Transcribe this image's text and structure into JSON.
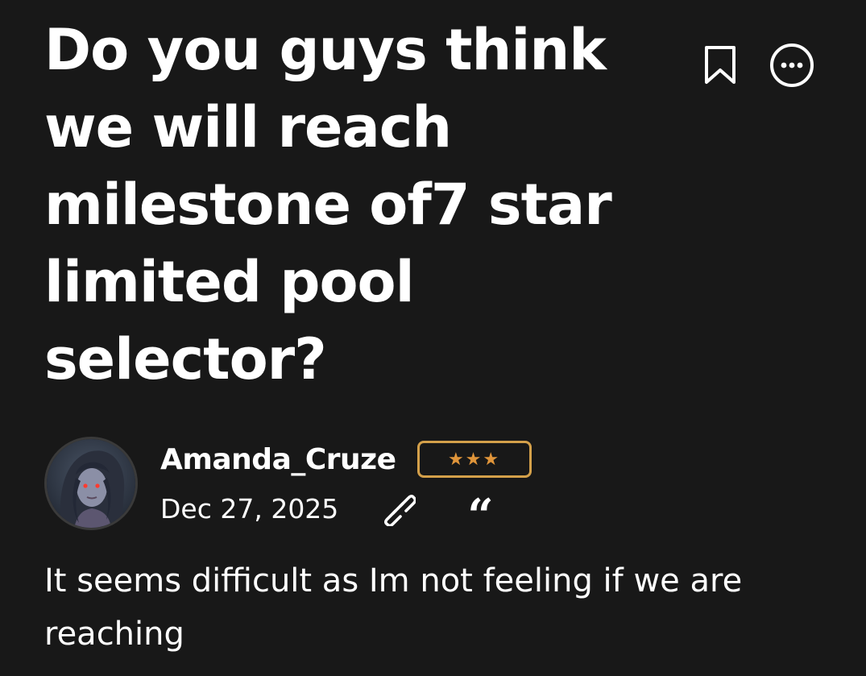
{
  "post": {
    "title": "Do you guys think we will reach milestone of7 star limited pool selector?",
    "body": "It seems difficult as Im not feeling if we are reaching"
  },
  "author": {
    "name": "Amanda_Cruze",
    "badge": "★★★",
    "date": "Dec 27, 2025"
  },
  "icons": {
    "bookmark": "bookmark-icon",
    "more": "more-options-icon",
    "link": "link-icon",
    "quote": "quote-icon",
    "quote_glyph": "“"
  },
  "colors": {
    "background": "#181818",
    "text": "#ffffff",
    "badge_border": "#d4a04a",
    "badge_stars": "#e0953a"
  }
}
